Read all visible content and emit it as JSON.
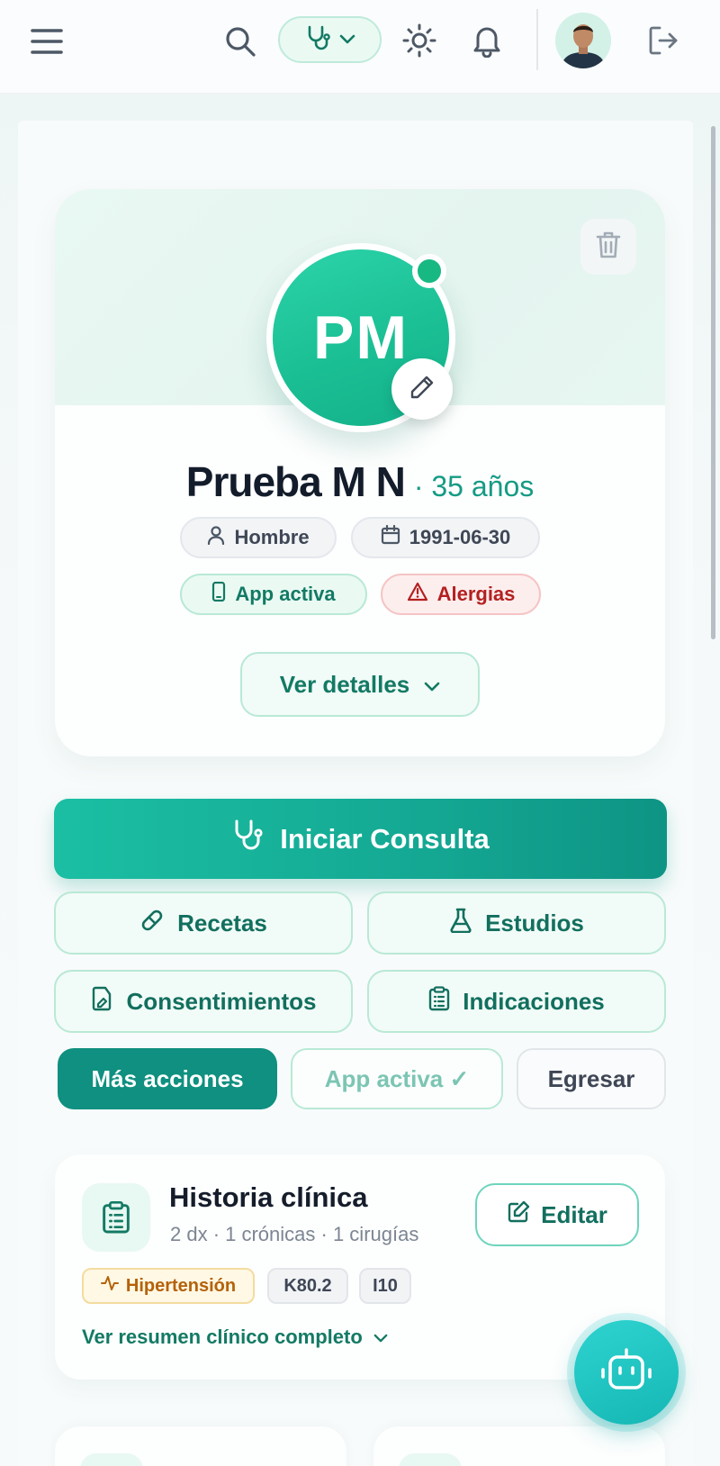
{
  "header": {
    "icons": [
      "menu-icon",
      "search-icon",
      "stethoscope-icon",
      "chevron-down-icon",
      "sun-icon",
      "bell-icon",
      "avatar",
      "logout-icon"
    ]
  },
  "patient": {
    "initials": "PM",
    "name": "Prueba M N",
    "age": "· 35 años",
    "gender": "Hombre",
    "birthdate": "1991-06-30",
    "app_status": "App activa",
    "allergies": "Alergias",
    "details_button": "Ver detalles"
  },
  "actions": {
    "start_consult": "Iniciar Consulta",
    "recetas": "Recetas",
    "estudios": "Estudios",
    "consentimientos": "Consentimientos",
    "indicaciones": "Indicaciones",
    "mas_acciones": "Más acciones",
    "app_activa": "App activa ✓",
    "egresar": "Egresar"
  },
  "history": {
    "title": "Historia clínica",
    "subtitle": "2 dx · 1 crónicas · 1 cirugías",
    "edit_label": "Editar",
    "tags": [
      "Hipertensión",
      "K80.2",
      "I10"
    ],
    "summary_link": "Ver resumen clínico completo"
  },
  "colors": {
    "primary": "#14a893",
    "primary_dark": "#0f9080",
    "accent_text": "#137a64",
    "danger": "#b42020",
    "warning": "#b4620a"
  }
}
